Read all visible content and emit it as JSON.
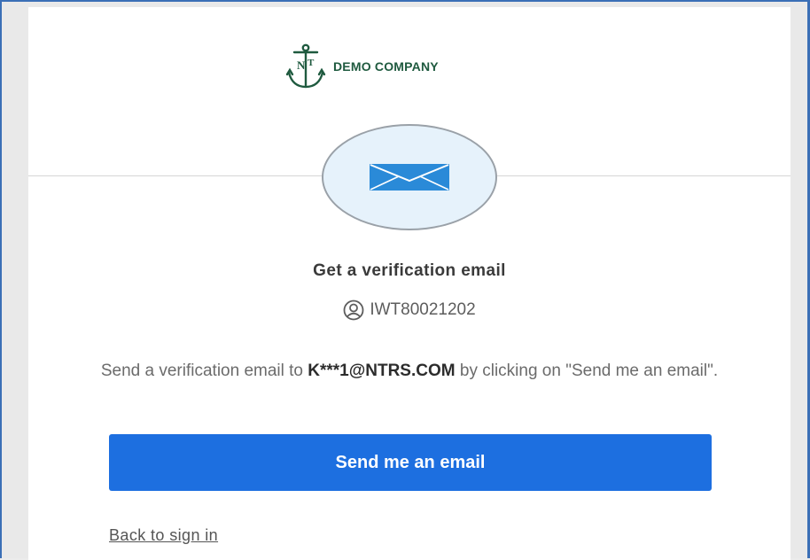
{
  "logo": {
    "text": "DEMO COMPANY",
    "icon": "anchor-nt-monogram",
    "color": "#1f5a3f"
  },
  "badge": {
    "icon": "envelope-icon",
    "color": "#2a8ad8",
    "background": "#e6f2fb"
  },
  "heading": "Get a verification email",
  "identity": {
    "icon": "user-circle-icon",
    "username": "IWT80021202"
  },
  "instructions": {
    "prefix": "Send a verification email to ",
    "masked_email": "K***1@NTRS.COM",
    "suffix": " by clicking on \"Send me an email\"."
  },
  "send_button_label": "Send me an email",
  "back_link_label": "Back to sign in",
  "colors": {
    "primary": "#1d6fe0",
    "frame": "#3b6fb6"
  }
}
